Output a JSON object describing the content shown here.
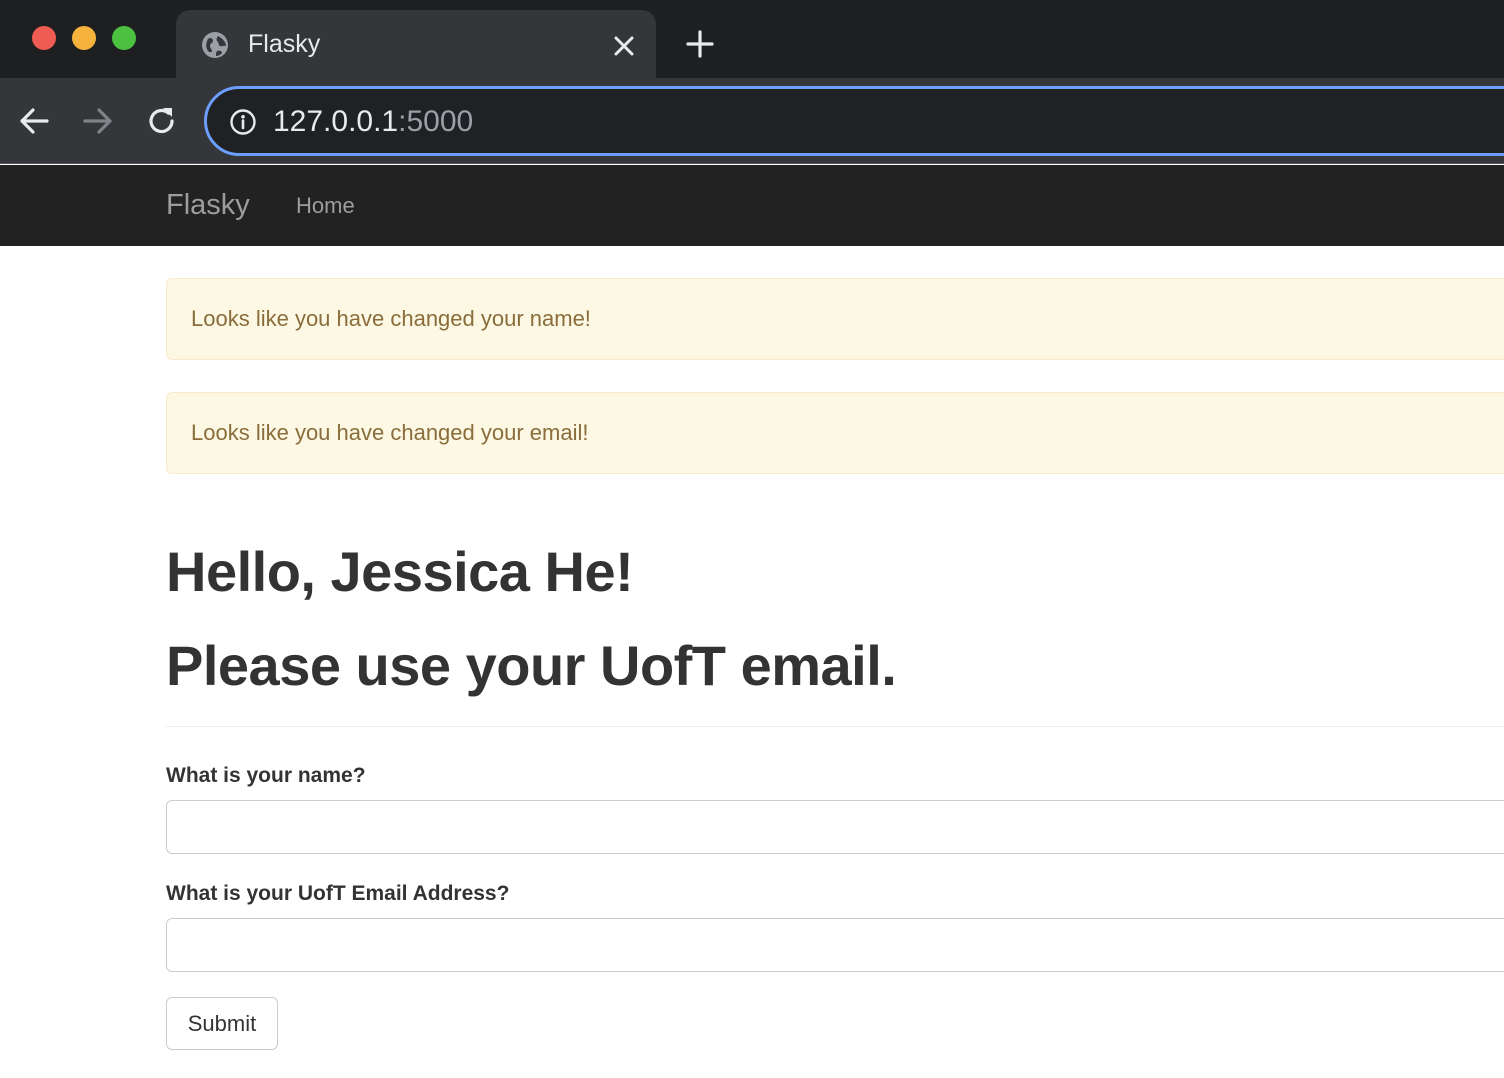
{
  "browser": {
    "tab_title": "Flasky",
    "url_host": "127.0.0.1",
    "url_port": ":5000",
    "colors": {
      "omnibox_focus": "#6c9eff",
      "chrome_bg": "#35363a"
    }
  },
  "navbar": {
    "brand": "Flasky",
    "links": [
      "Home"
    ]
  },
  "alerts": [
    "Looks like you have changed your name!",
    "Looks like you have changed your email!"
  ],
  "main": {
    "greeting": "Hello, Jessica He!",
    "notice": "Please use your UofT email."
  },
  "form": {
    "name_label": "What is your name?",
    "name_value": "",
    "email_label": "What is your UofT Email Address?",
    "email_value": "",
    "submit_label": "Submit"
  },
  "icons": {
    "tab_favicon": "globe-icon",
    "tab_close": "close-icon",
    "new_tab": "plus-icon",
    "back": "arrow-left-icon",
    "forward": "arrow-right-icon",
    "reload": "reload-icon",
    "site_info": "info-icon"
  }
}
